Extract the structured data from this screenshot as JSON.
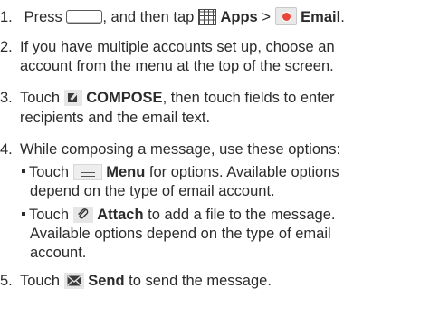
{
  "steps": {
    "s1": {
      "num": "1.",
      "t1": "Press",
      "t2": ", and then tap",
      "apps": "Apps",
      "sep": ">",
      "email": "Email",
      "end": "."
    },
    "s2": {
      "num": "2.",
      "l1": "If you have multiple accounts set up, choose an",
      "l2": "account from the menu at the top of the screen."
    },
    "s3": {
      "num": "3.",
      "t1": "Touch",
      "compose": "COMPOSE",
      "t2": ", then touch fields to enter",
      "l2": "recipients and the email text."
    },
    "s4": {
      "num": "4.",
      "l1": "While composing a message, use these options:"
    },
    "b1": {
      "t1": "Touch",
      "menu": "Menu",
      "t2": "for options. Available options",
      "l2": "depend on the type of email account."
    },
    "b2": {
      "t1": "Touch",
      "attach": "Attach",
      "t2": "to add a file to the message.",
      "l2": "Available options depend on the type of email",
      "l3": "account."
    },
    "s5": {
      "num": "5.",
      "t1": "Touch",
      "send": "Send",
      "t2": "to send the message."
    }
  },
  "icons": [
    "home-key-icon",
    "apps-icon",
    "email-app-icon",
    "compose-icon",
    "menu-icon",
    "attach-icon",
    "send-icon"
  ]
}
